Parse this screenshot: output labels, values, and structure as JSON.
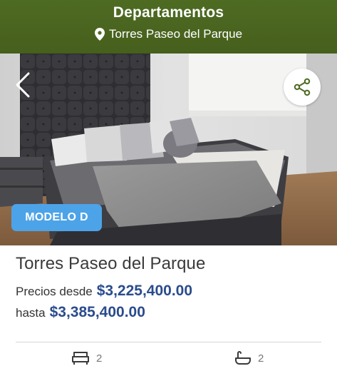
{
  "header": {
    "title": "Departamentos",
    "location": "Torres Paseo del Parque",
    "icons": {
      "location": "map-pin-icon"
    }
  },
  "gallery": {
    "prev_icon": "chevron-left-icon",
    "share_icon": "share-icon",
    "badge": "MODELO D"
  },
  "listing": {
    "title": "Torres Paseo del Parque",
    "price_from_label": "Precios desde",
    "price_from": "$3,225,400.00",
    "price_to_label": "hasta",
    "price_to": "$3,385,400.00",
    "bedrooms": "2",
    "bathrooms": "2",
    "icons": {
      "bedrooms": "bed-icon",
      "bathrooms": "bathtub-icon"
    }
  },
  "colors": {
    "header_bg": "#4e6b22",
    "badge_bg": "#4da3e8",
    "price": "#2a4c8c"
  }
}
